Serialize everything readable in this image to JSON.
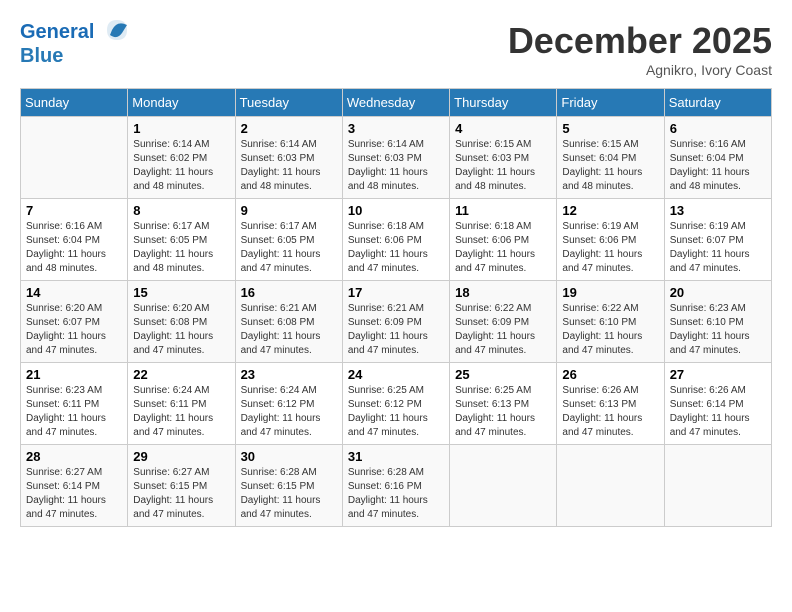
{
  "header": {
    "logo_line1": "General",
    "logo_line2": "Blue",
    "month": "December 2025",
    "location": "Agnikro, Ivory Coast"
  },
  "days_of_week": [
    "Sunday",
    "Monday",
    "Tuesday",
    "Wednesday",
    "Thursday",
    "Friday",
    "Saturday"
  ],
  "weeks": [
    [
      {
        "day": "",
        "info": ""
      },
      {
        "day": "1",
        "info": "Sunrise: 6:14 AM\nSunset: 6:02 PM\nDaylight: 11 hours\nand 48 minutes."
      },
      {
        "day": "2",
        "info": "Sunrise: 6:14 AM\nSunset: 6:03 PM\nDaylight: 11 hours\nand 48 minutes."
      },
      {
        "day": "3",
        "info": "Sunrise: 6:14 AM\nSunset: 6:03 PM\nDaylight: 11 hours\nand 48 minutes."
      },
      {
        "day": "4",
        "info": "Sunrise: 6:15 AM\nSunset: 6:03 PM\nDaylight: 11 hours\nand 48 minutes."
      },
      {
        "day": "5",
        "info": "Sunrise: 6:15 AM\nSunset: 6:04 PM\nDaylight: 11 hours\nand 48 minutes."
      },
      {
        "day": "6",
        "info": "Sunrise: 6:16 AM\nSunset: 6:04 PM\nDaylight: 11 hours\nand 48 minutes."
      }
    ],
    [
      {
        "day": "7",
        "info": "Sunrise: 6:16 AM\nSunset: 6:04 PM\nDaylight: 11 hours\nand 48 minutes."
      },
      {
        "day": "8",
        "info": "Sunrise: 6:17 AM\nSunset: 6:05 PM\nDaylight: 11 hours\nand 48 minutes."
      },
      {
        "day": "9",
        "info": "Sunrise: 6:17 AM\nSunset: 6:05 PM\nDaylight: 11 hours\nand 47 minutes."
      },
      {
        "day": "10",
        "info": "Sunrise: 6:18 AM\nSunset: 6:06 PM\nDaylight: 11 hours\nand 47 minutes."
      },
      {
        "day": "11",
        "info": "Sunrise: 6:18 AM\nSunset: 6:06 PM\nDaylight: 11 hours\nand 47 minutes."
      },
      {
        "day": "12",
        "info": "Sunrise: 6:19 AM\nSunset: 6:06 PM\nDaylight: 11 hours\nand 47 minutes."
      },
      {
        "day": "13",
        "info": "Sunrise: 6:19 AM\nSunset: 6:07 PM\nDaylight: 11 hours\nand 47 minutes."
      }
    ],
    [
      {
        "day": "14",
        "info": "Sunrise: 6:20 AM\nSunset: 6:07 PM\nDaylight: 11 hours\nand 47 minutes."
      },
      {
        "day": "15",
        "info": "Sunrise: 6:20 AM\nSunset: 6:08 PM\nDaylight: 11 hours\nand 47 minutes."
      },
      {
        "day": "16",
        "info": "Sunrise: 6:21 AM\nSunset: 6:08 PM\nDaylight: 11 hours\nand 47 minutes."
      },
      {
        "day": "17",
        "info": "Sunrise: 6:21 AM\nSunset: 6:09 PM\nDaylight: 11 hours\nand 47 minutes."
      },
      {
        "day": "18",
        "info": "Sunrise: 6:22 AM\nSunset: 6:09 PM\nDaylight: 11 hours\nand 47 minutes."
      },
      {
        "day": "19",
        "info": "Sunrise: 6:22 AM\nSunset: 6:10 PM\nDaylight: 11 hours\nand 47 minutes."
      },
      {
        "day": "20",
        "info": "Sunrise: 6:23 AM\nSunset: 6:10 PM\nDaylight: 11 hours\nand 47 minutes."
      }
    ],
    [
      {
        "day": "21",
        "info": "Sunrise: 6:23 AM\nSunset: 6:11 PM\nDaylight: 11 hours\nand 47 minutes."
      },
      {
        "day": "22",
        "info": "Sunrise: 6:24 AM\nSunset: 6:11 PM\nDaylight: 11 hours\nand 47 minutes."
      },
      {
        "day": "23",
        "info": "Sunrise: 6:24 AM\nSunset: 6:12 PM\nDaylight: 11 hours\nand 47 minutes."
      },
      {
        "day": "24",
        "info": "Sunrise: 6:25 AM\nSunset: 6:12 PM\nDaylight: 11 hours\nand 47 minutes."
      },
      {
        "day": "25",
        "info": "Sunrise: 6:25 AM\nSunset: 6:13 PM\nDaylight: 11 hours\nand 47 minutes."
      },
      {
        "day": "26",
        "info": "Sunrise: 6:26 AM\nSunset: 6:13 PM\nDaylight: 11 hours\nand 47 minutes."
      },
      {
        "day": "27",
        "info": "Sunrise: 6:26 AM\nSunset: 6:14 PM\nDaylight: 11 hours\nand 47 minutes."
      }
    ],
    [
      {
        "day": "28",
        "info": "Sunrise: 6:27 AM\nSunset: 6:14 PM\nDaylight: 11 hours\nand 47 minutes."
      },
      {
        "day": "29",
        "info": "Sunrise: 6:27 AM\nSunset: 6:15 PM\nDaylight: 11 hours\nand 47 minutes."
      },
      {
        "day": "30",
        "info": "Sunrise: 6:28 AM\nSunset: 6:15 PM\nDaylight: 11 hours\nand 47 minutes."
      },
      {
        "day": "31",
        "info": "Sunrise: 6:28 AM\nSunset: 6:16 PM\nDaylight: 11 hours\nand 47 minutes."
      },
      {
        "day": "",
        "info": ""
      },
      {
        "day": "",
        "info": ""
      },
      {
        "day": "",
        "info": ""
      }
    ]
  ]
}
